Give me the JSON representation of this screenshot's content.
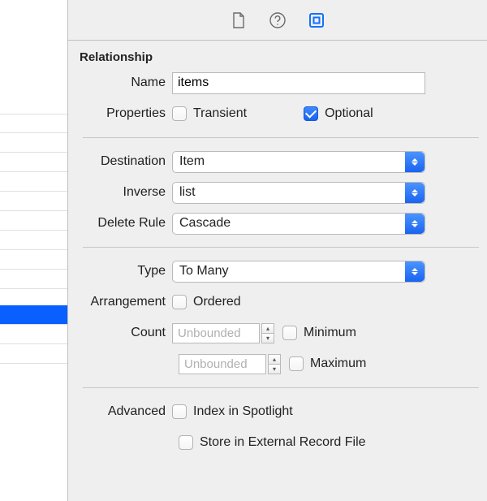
{
  "section_title": "Relationship",
  "labels": {
    "name": "Name",
    "properties": "Properties",
    "destination": "Destination",
    "inverse": "Inverse",
    "delete_rule": "Delete Rule",
    "type": "Type",
    "arrangement": "Arrangement",
    "count": "Count",
    "advanced": "Advanced"
  },
  "values": {
    "name": "items",
    "destination": "Item",
    "inverse": "list",
    "delete_rule": "Cascade",
    "type": "To Many",
    "count_min_placeholder": "Unbounded",
    "count_max_placeholder": "Unbounded"
  },
  "check_labels": {
    "transient": "Transient",
    "optional": "Optional",
    "ordered": "Ordered",
    "minimum": "Minimum",
    "maximum": "Maximum",
    "index_spotlight": "Index in Spotlight",
    "store_external": "Store in External Record File"
  },
  "checks": {
    "transient": false,
    "optional": true,
    "ordered": false,
    "minimum": false,
    "maximum": false,
    "index_spotlight": false,
    "store_external": false
  }
}
